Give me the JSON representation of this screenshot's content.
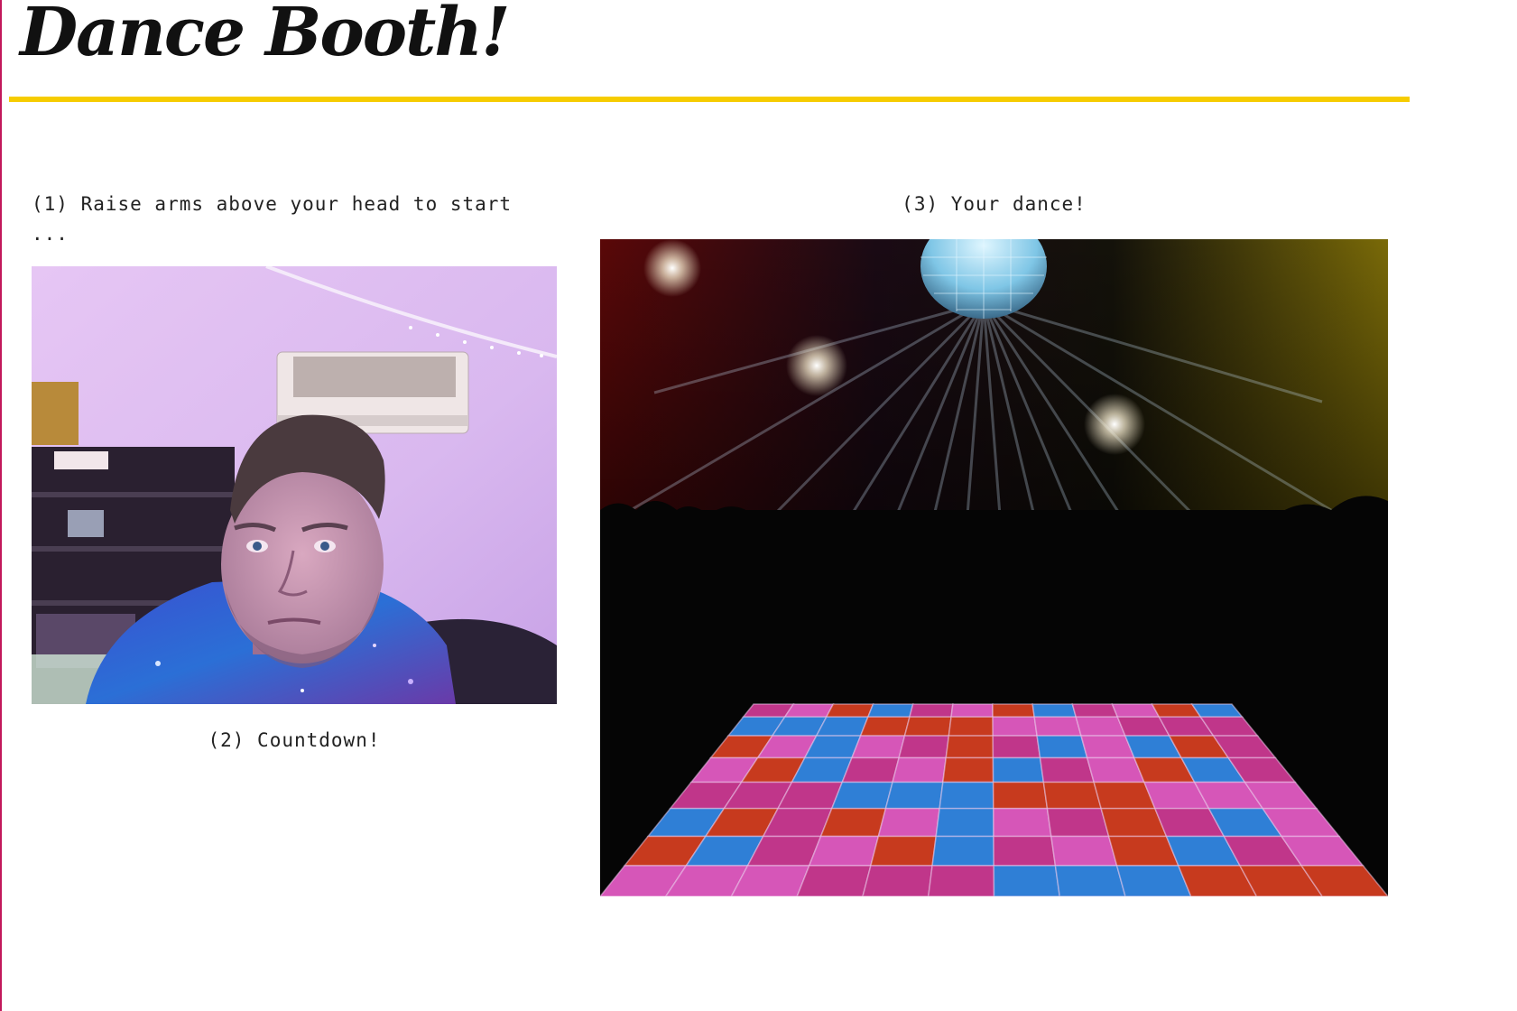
{
  "app": {
    "title": "Dance Booth!",
    "accent_color": "#f6cc00"
  },
  "steps": {
    "step1_label": "(1) Raise arms above your head to start",
    "step1_status": "...",
    "step2_label": "(2) Countdown!",
    "step3_label": "(3) Your dance!"
  },
  "media": {
    "webcam_feed": "webcam-preview-image",
    "dance_scene": "disco-dance-floor-image"
  }
}
